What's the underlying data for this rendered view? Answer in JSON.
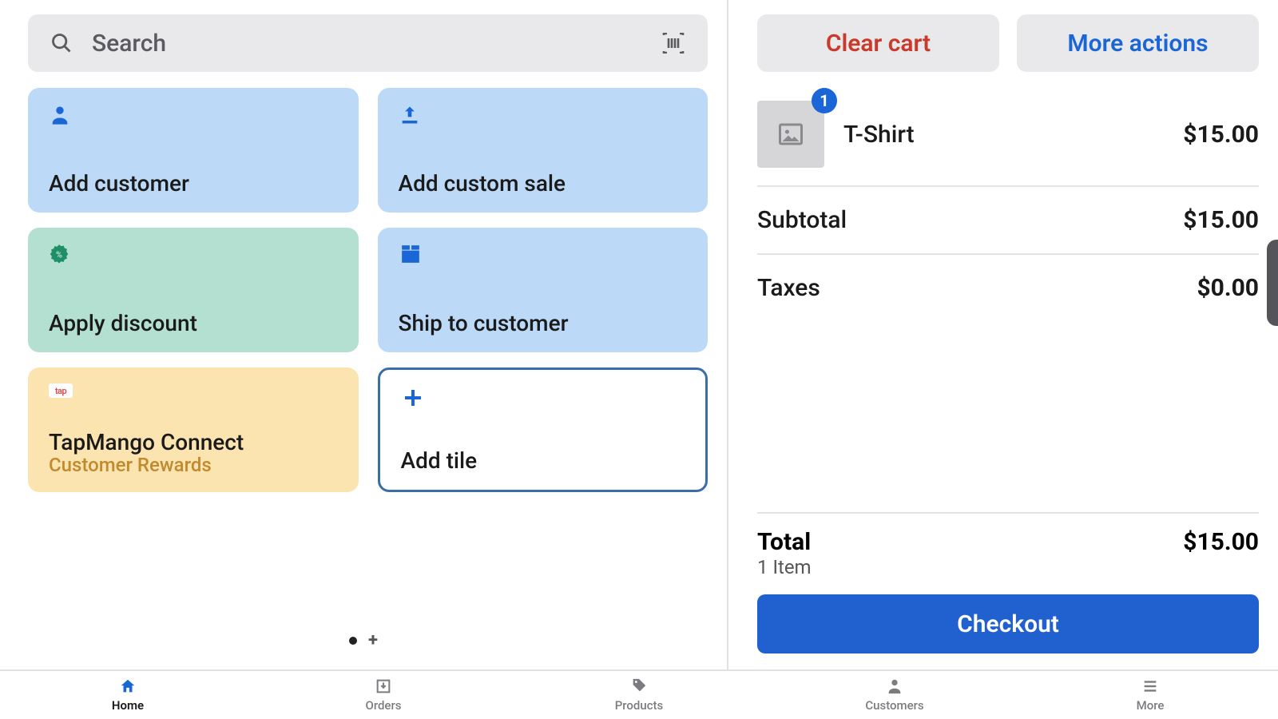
{
  "search": {
    "placeholder": "Search"
  },
  "tiles": {
    "add_customer": "Add customer",
    "add_custom_sale": "Add custom sale",
    "apply_discount": "Apply discount",
    "ship_to_customer": "Ship to customer",
    "tapmango_title": "TapMango Connect",
    "tapmango_sub": "Customer Rewards",
    "tapmango_badge": "tap",
    "add_tile": "Add tile"
  },
  "cart_actions": {
    "clear": "Clear cart",
    "more": "More actions"
  },
  "cart": {
    "items": [
      {
        "qty": "1",
        "name": "T-Shirt",
        "price": "$15.00"
      }
    ],
    "subtotal_label": "Subtotal",
    "subtotal_value": "$15.00",
    "taxes_label": "Taxes",
    "taxes_value": "$0.00",
    "total_label": "Total",
    "total_count": "1 Item",
    "total_value": "$15.00",
    "checkout": "Checkout"
  },
  "nav": {
    "home": "Home",
    "orders": "Orders",
    "products": "Products",
    "customers": "Customers",
    "more": "More"
  },
  "colors": {
    "accent": "#1a66d6",
    "danger": "#c93a2a",
    "tile_blue": "#bcd9f7",
    "tile_green": "#b4e0d1",
    "tile_yellow": "#fce4b1"
  }
}
